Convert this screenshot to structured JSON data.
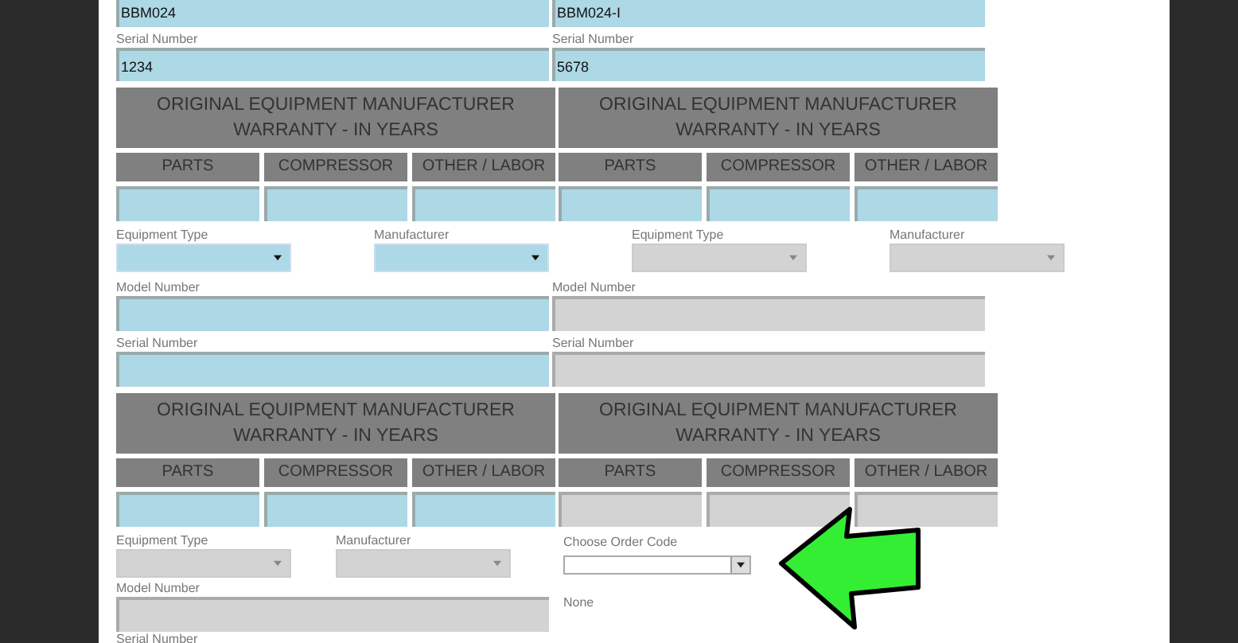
{
  "top_fields": [
    {
      "value": "BBM024",
      "disabled": false
    },
    {
      "value": "BBM024-I",
      "disabled": false
    }
  ],
  "serial_fields": [
    {
      "label": "Serial Number",
      "value": "1234",
      "disabled": false
    },
    {
      "label": "Serial Number",
      "value": "5678",
      "disabled": false
    }
  ],
  "warranty_tables_1": [
    {
      "title": "ORIGINAL EQUIPMENT MANUFACTURER WARRANTY - IN YEARS",
      "columns": [
        "PARTS",
        "COMPRESSOR",
        "OTHER / LABOR"
      ],
      "disabled": false
    },
    {
      "title": "ORIGINAL EQUIPMENT MANUFACTURER WARRANTY - IN YEARS",
      "columns": [
        "PARTS",
        "COMPRESSOR",
        "OTHER / LABOR"
      ],
      "disabled": false
    }
  ],
  "dropdowns": [
    {
      "label": "Equipment Type",
      "disabled": false
    },
    {
      "label": "Manufacturer",
      "disabled": false
    },
    {
      "label": "Equipment Type",
      "disabled": true
    },
    {
      "label": "Manufacturer",
      "disabled": true
    }
  ],
  "model_fields": [
    {
      "label": "Model Number",
      "disabled": false
    },
    {
      "label": "Model Number",
      "disabled": true
    }
  ],
  "serial_fields_2": [
    {
      "label": "Serial Number",
      "disabled": false
    },
    {
      "label": "Serial Number",
      "disabled": true
    }
  ],
  "warranty_tables_2": [
    {
      "title": "ORIGINAL EQUIPMENT MANUFACTURER WARRANTY - IN YEARS",
      "columns": [
        "PARTS",
        "COMPRESSOR",
        "OTHER / LABOR"
      ],
      "disabled": false
    },
    {
      "title": "ORIGINAL EQUIPMENT MANUFACTURER WARRANTY - IN YEARS",
      "columns": [
        "PARTS",
        "COMPRESSOR",
        "OTHER / LABOR"
      ],
      "disabled": true
    }
  ],
  "bottom": {
    "dropdowns": [
      {
        "label": "Equipment Type",
        "disabled": true
      },
      {
        "label": "Manufacturer",
        "disabled": true
      }
    ],
    "model_field": {
      "label": "Model Number",
      "disabled": true
    },
    "serial_label": "Serial Number",
    "order_code": {
      "label": "Choose Order Code",
      "value": "None"
    }
  }
}
